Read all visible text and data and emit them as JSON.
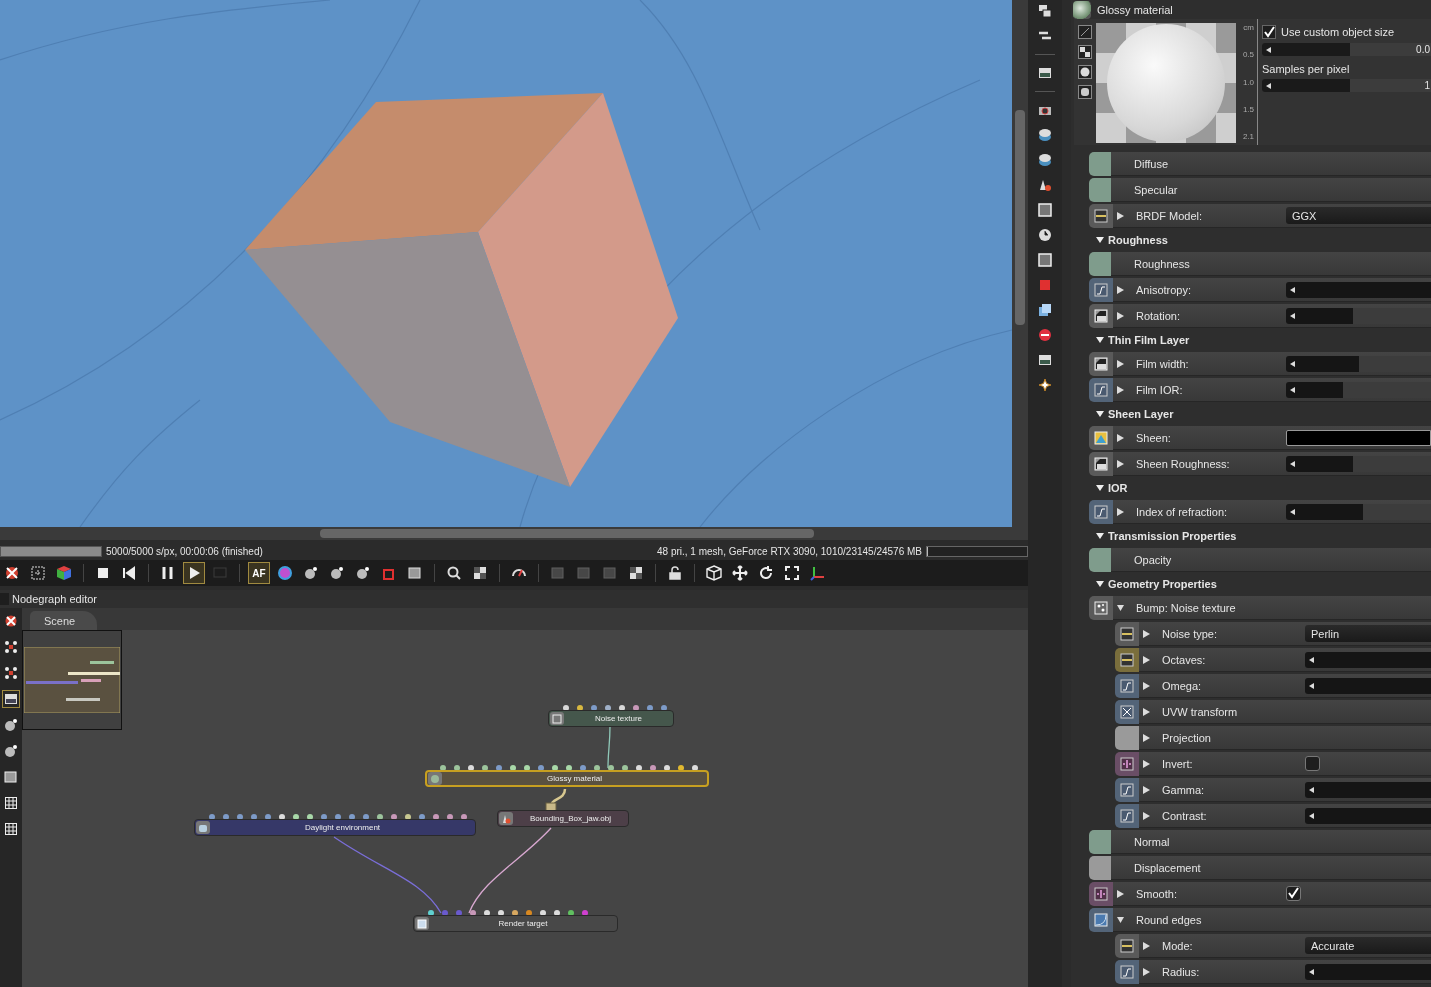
{
  "viewport": {
    "status": "5000/5000 s/px, 00:00:06 (finished)",
    "progress": {
      "level": 1
    },
    "stats": "48 pri., 1 mesh, GeForce RTX 3090, 1010/23145/24576 MB",
    "memory": {
      "level": 0.01
    }
  },
  "toolbar": [
    {
      "kind": "reset",
      "selected": false,
      "disabled": false
    },
    {
      "kind": "expand",
      "selected": false,
      "disabled": false
    },
    {
      "kind": "cube",
      "selected": false,
      "disabled": false
    },
    {
      "kind": "sep"
    },
    {
      "kind": "stop",
      "selected": false,
      "disabled": false
    },
    {
      "kind": "rewind",
      "selected": false,
      "disabled": false
    },
    {
      "kind": "sep"
    },
    {
      "kind": "pause",
      "selected": false,
      "disabled": false
    },
    {
      "kind": "play",
      "selected": true,
      "disabled": false
    },
    {
      "kind": "monitor",
      "selected": false,
      "disabled": true
    },
    {
      "kind": "sep"
    },
    {
      "kind": "text",
      "label": "AF",
      "selected": true,
      "disabled": false
    },
    {
      "kind": "wheel",
      "selected": false,
      "disabled": false
    },
    {
      "kind": "sphere",
      "selected": false,
      "disabled": false
    },
    {
      "kind": "sphere",
      "selected": false,
      "disabled": false
    },
    {
      "kind": "sphere",
      "selected": false,
      "disabled": false
    },
    {
      "kind": "square",
      "selected": false,
      "disabled": false
    },
    {
      "kind": "frame",
      "selected": false,
      "disabled": false
    },
    {
      "kind": "sep"
    },
    {
      "kind": "magnifier",
      "selected": false,
      "disabled": false
    },
    {
      "kind": "tiles",
      "selected": false,
      "disabled": false
    },
    {
      "kind": "sep"
    },
    {
      "kind": "gauge",
      "selected": false,
      "disabled": false
    },
    {
      "kind": "sep"
    },
    {
      "kind": "frame",
      "selected": false,
      "disabled": true
    },
    {
      "kind": "frame",
      "selected": false,
      "disabled": true
    },
    {
      "kind": "frame",
      "selected": false,
      "disabled": true
    },
    {
      "kind": "tiles",
      "selected": false,
      "disabled": false
    },
    {
      "kind": "sep"
    },
    {
      "kind": "lock",
      "selected": false,
      "disabled": false
    },
    {
      "kind": "sep"
    },
    {
      "kind": "box",
      "selected": false,
      "disabled": false
    },
    {
      "kind": "move",
      "selected": false,
      "disabled": false
    },
    {
      "kind": "rotate",
      "selected": false,
      "disabled": false
    },
    {
      "kind": "fit",
      "selected": false,
      "disabled": false
    },
    {
      "kind": "axis",
      "selected": false,
      "disabled": false
    }
  ],
  "nodegraph": {
    "title": "Nodegraph editor",
    "tools": [
      {
        "kind": "reset",
        "selected": false
      },
      {
        "kind": "expand",
        "selected": false
      },
      {
        "kind": "expand",
        "selected": false
      },
      {
        "kind": "image",
        "selected": true
      },
      {
        "kind": "sphere",
        "selected": false
      },
      {
        "kind": "sphere",
        "selected": false
      },
      {
        "kind": "frame",
        "selected": false
      },
      {
        "kind": "grid",
        "selected": false
      },
      {
        "kind": "grid",
        "selected": false
      }
    ],
    "tabs": [
      {
        "label": "Scene",
        "selected": true
      }
    ],
    "nodes": [
      {
        "kind": "texture",
        "title": "Noise texture",
        "selected": false,
        "ports": [
          {
            "color": "#d8d8d8"
          },
          {
            "color": "#d8b840"
          },
          {
            "color": "#7d9bc8"
          },
          {
            "color": "#9fb0c8"
          },
          {
            "color": "#d8d8d8"
          },
          {
            "color": "#c898b8"
          },
          {
            "color": "#7d9bc8"
          },
          {
            "color": "#7d9bc8"
          }
        ]
      },
      {
        "kind": "material",
        "title": "Glossy material",
        "selected": true,
        "ports": [
          {
            "color": "#9cc49c"
          },
          {
            "color": "#9cc49c"
          },
          {
            "color": "#dcdcdc"
          },
          {
            "color": "#9cc49c"
          },
          {
            "color": "#7d9bc8"
          },
          {
            "color": "#a8d8a8"
          },
          {
            "color": "#a8d8a8"
          },
          {
            "color": "#7d9bc8"
          },
          {
            "color": "#a8d8a8"
          },
          {
            "color": "#a8d8a8"
          },
          {
            "color": "#7d9bc8"
          },
          {
            "color": "#9cc49c"
          },
          {
            "color": "#9cc49c"
          },
          {
            "color": "#9cc49c"
          },
          {
            "color": "#dcdcdc"
          },
          {
            "color": "#c898b8"
          },
          {
            "color": "#dcdcdc"
          },
          {
            "color": "#e0b830"
          },
          {
            "color": "#dcdcdc"
          }
        ]
      },
      {
        "kind": "mesh",
        "title": "Bounding_Box_jaw.obj",
        "selected": false
      },
      {
        "kind": "environment",
        "title": "Daylight environment",
        "selected": false,
        "ports": [
          {
            "color": "#7d9bc8"
          },
          {
            "color": "#7d9bc8"
          },
          {
            "color": "#7d9bc8"
          },
          {
            "color": "#7d9bc8"
          },
          {
            "color": "#7d9bc8"
          },
          {
            "color": "#dcdcdc"
          },
          {
            "color": "#a8d8a8"
          },
          {
            "color": "#a8d8a8"
          },
          {
            "color": "#7d9bc8"
          },
          {
            "color": "#7d9bc8"
          },
          {
            "color": "#7d9bc8"
          },
          {
            "color": "#7d9bc8"
          },
          {
            "color": "#9cc49c"
          },
          {
            "color": "#c898b8"
          },
          {
            "color": "#c8c890"
          },
          {
            "color": "#7d9bc8"
          },
          {
            "color": "#c898b8"
          },
          {
            "color": "#c898b8"
          },
          {
            "color": "#c898b8"
          }
        ]
      },
      {
        "kind": "render",
        "title": "Render target",
        "selected": false,
        "ports": [
          {
            "color": "#60d0d0"
          },
          {
            "color": "#6a5acd"
          },
          {
            "color": "#6a5acd"
          },
          {
            "color": "#c898b8"
          },
          {
            "color": "#dcdcdc"
          },
          {
            "color": "#dcdcdc"
          },
          {
            "color": "#d8a860"
          },
          {
            "color": "#d88820"
          },
          {
            "color": "#dcdcdc"
          },
          {
            "color": "#dcdcdc"
          },
          {
            "color": "#60c060"
          },
          {
            "color": "#d040d0"
          }
        ]
      }
    ]
  },
  "inspector": {
    "title": "Glossy material",
    "ruler": [
      "cm",
      "0.5",
      "1.0",
      "1.5",
      "2.1"
    ],
    "custom_size": {
      "label": "Use custom object size",
      "checked": true,
      "level": 0.52,
      "value": "0.0"
    },
    "samples": {
      "label": "Samples per pixel",
      "level": 0.52,
      "value": "1"
    },
    "rows": [
      {
        "kind": "pin",
        "label": "Diffuse",
        "color": "#7f9c8c"
      },
      {
        "kind": "pin",
        "label": "Specular",
        "color": "#7f9c8c"
      },
      {
        "kind": "enum",
        "label": "BRDF Model:",
        "value": "GGX",
        "expanded": false
      },
      {
        "kind": "section",
        "label": "Roughness",
        "expanded": true
      },
      {
        "kind": "pin",
        "label": "Roughness",
        "color": "#7f9c8c"
      },
      {
        "kind": "slider",
        "label": "Anisotropy:",
        "level": 1,
        "expanded": false
      },
      {
        "kind": "slider",
        "label": "Rotation:",
        "level": 0.46,
        "expanded": false
      },
      {
        "kind": "section",
        "label": "Thin Film Layer",
        "expanded": true
      },
      {
        "kind": "slider",
        "label": "Film width:",
        "level": 0.5,
        "expanded": false
      },
      {
        "kind": "slider",
        "label": "Film IOR:",
        "level": 0.39,
        "expanded": false
      },
      {
        "kind": "section",
        "label": "Sheen Layer",
        "expanded": true
      },
      {
        "kind": "color",
        "label": "Sheen:",
        "color": "#000000",
        "expanded": false
      },
      {
        "kind": "slider",
        "label": "Sheen Roughness:",
        "level": 0.46,
        "expanded": false
      },
      {
        "kind": "section",
        "label": "IOR",
        "expanded": true
      },
      {
        "kind": "slider",
        "label": "Index of refraction:",
        "level": 0.53,
        "expanded": false
      },
      {
        "kind": "section",
        "label": "Transmission Properties",
        "expanded": true
      },
      {
        "kind": "pin",
        "label": "Opacity",
        "color": "#7f9c8c"
      },
      {
        "kind": "section",
        "label": "Geometry Properties",
        "expanded": true
      },
      {
        "kind": "group",
        "label": "Bump: Noise texture",
        "expanded": true,
        "children": [
          {
            "kind": "enum",
            "label": "Noise type:",
            "value": "Perlin",
            "expanded": false
          },
          {
            "kind": "slider",
            "label": "Octaves:",
            "level": 1,
            "expanded": false
          },
          {
            "kind": "slider",
            "label": "Omega:",
            "level": 1,
            "expanded": false
          },
          {
            "kind": "link",
            "label": "UVW transform",
            "expanded": false
          },
          {
            "kind": "link",
            "label": "Projection",
            "expanded": false
          },
          {
            "kind": "check",
            "label": "Invert:",
            "checked": false,
            "expanded": false
          },
          {
            "kind": "slider",
            "label": "Gamma:",
            "level": 1,
            "expanded": false
          },
          {
            "kind": "slider",
            "label": "Contrast:",
            "level": 1,
            "expanded": false
          }
        ]
      },
      {
        "kind": "pin",
        "label": "Normal",
        "color": "#7f9c8c"
      },
      {
        "kind": "pin",
        "label": "Displacement",
        "color": "#9a9a9a"
      },
      {
        "kind": "check",
        "label": "Smooth:",
        "checked": true,
        "expanded": false
      },
      {
        "kind": "group",
        "label": "Round edges",
        "expanded": true,
        "children": [
          {
            "kind": "enum",
            "label": "Mode:",
            "value": "Accurate",
            "expanded": false
          },
          {
            "kind": "slider",
            "label": "Radius:",
            "level": 1,
            "expanded": false
          }
        ]
      }
    ]
  }
}
